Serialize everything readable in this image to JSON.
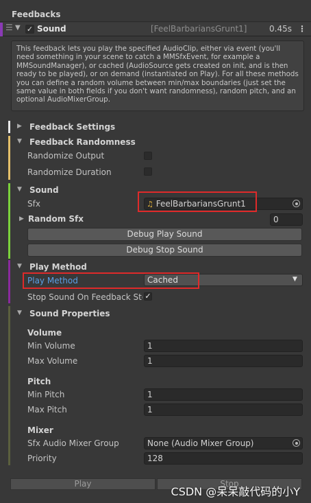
{
  "header": {
    "title": "Feedbacks"
  },
  "feedback": {
    "name": "Sound",
    "label": "[FeelBarbariansGrunt1]",
    "duration": "0.45s",
    "enabled": true
  },
  "description": "This feedback lets you play the specified AudioClip, either via event (you'll need something in your scene to catch a MMSfxEvent, for example a MMSoundManager), or cached (AudioSource gets created on init, and is then ready to be played), or on demand (instantiated on Play). For all these methods you can define a random volume between min/max boundaries (just set the same value in both fields if you don't want randomness), random pitch, and an optional AudioMixerGroup.",
  "sections": {
    "feedback_settings": "Feedback Settings",
    "feedback_randomness": "Feedback Randomness",
    "sound": "Sound",
    "play_method": "Play Method",
    "sound_properties": "Sound Properties"
  },
  "randomness": {
    "randomize_output_label": "Randomize Output",
    "randomize_duration_label": "Randomize Duration",
    "randomize_output": false,
    "randomize_duration": false
  },
  "sound": {
    "sfx_label": "Sfx",
    "sfx_value": "FeelBarbariansGrunt1",
    "random_sfx_label": "Random Sfx",
    "random_sfx_count": "0",
    "debug_play_label": "Debug Play Sound",
    "debug_stop_label": "Debug Stop Sound"
  },
  "play_method": {
    "label": "Play Method",
    "value": "Cached",
    "stop_on_stop_label": "Stop Sound On Feedback Stop",
    "stop_on_stop_checked": true
  },
  "sound_properties": {
    "volume_header": "Volume",
    "min_volume_label": "Min Volume",
    "min_volume": "1",
    "max_volume_label": "Max Volume",
    "max_volume": "1",
    "pitch_header": "Pitch",
    "min_pitch_label": "Min Pitch",
    "min_pitch": "1",
    "max_pitch_label": "Max Pitch",
    "max_pitch": "1",
    "mixer_header": "Mixer",
    "mixer_group_label": "Sfx Audio Mixer Group",
    "mixer_group_value": "None (Audio Mixer Group)",
    "priority_label": "Priority",
    "priority": "128"
  },
  "footer": {
    "play_label": "Play",
    "stop_label": "Stop"
  },
  "watermark": "CSDN @呆呆敲代码的小Y",
  "colors": {
    "section_feedback_settings": "#e8e8e8",
    "section_randomness": "#e4c06a",
    "section_sound": "#7bd13c",
    "section_play_method": "#8a2a9e",
    "section_sound_properties": "#5b5f3e",
    "highlight": "#e02a2a",
    "label_active": "#5aa0e6"
  },
  "icons": {
    "menu": "hamburger-icon",
    "collapse": "triangle-down-icon",
    "expand": "triangle-right-icon",
    "audio_clip": "music-note-icon",
    "object_picker": "object-picker-icon",
    "dropdown": "chevron-down-icon",
    "more": "kebab-icon"
  }
}
